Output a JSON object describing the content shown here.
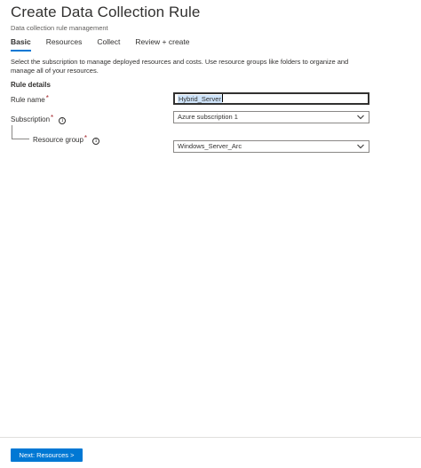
{
  "header": {
    "title": "Create Data Collection Rule",
    "subtitle": "Data collection rule management"
  },
  "tabs": [
    {
      "label": "Basic",
      "active": true
    },
    {
      "label": "Resources",
      "active": false
    },
    {
      "label": "Collect",
      "active": false
    },
    {
      "label": "Review + create",
      "active": false
    }
  ],
  "description": "Select the subscription to manage deployed resources and costs. Use resource groups like folders to organize and manage all of your resources.",
  "rule_details": {
    "heading": "Rule details",
    "rule_name": {
      "label": "Rule name",
      "required": "*",
      "value": "Hybrid_Server"
    },
    "subscription": {
      "label": "Subscription",
      "required": "*",
      "value": "Azure subscription 1"
    },
    "resource_group": {
      "label": "Resource group",
      "required": "*",
      "value": "Windows_Server_Arc"
    }
  },
  "footer": {
    "next_label": "Next: Resources >"
  },
  "colors": {
    "accent": "#0078d4",
    "required": "#a4262c",
    "selection": "#cfe4fa"
  },
  "icons": {
    "info": "info-circle-icon",
    "dropdown": "chevron-down-icon"
  }
}
